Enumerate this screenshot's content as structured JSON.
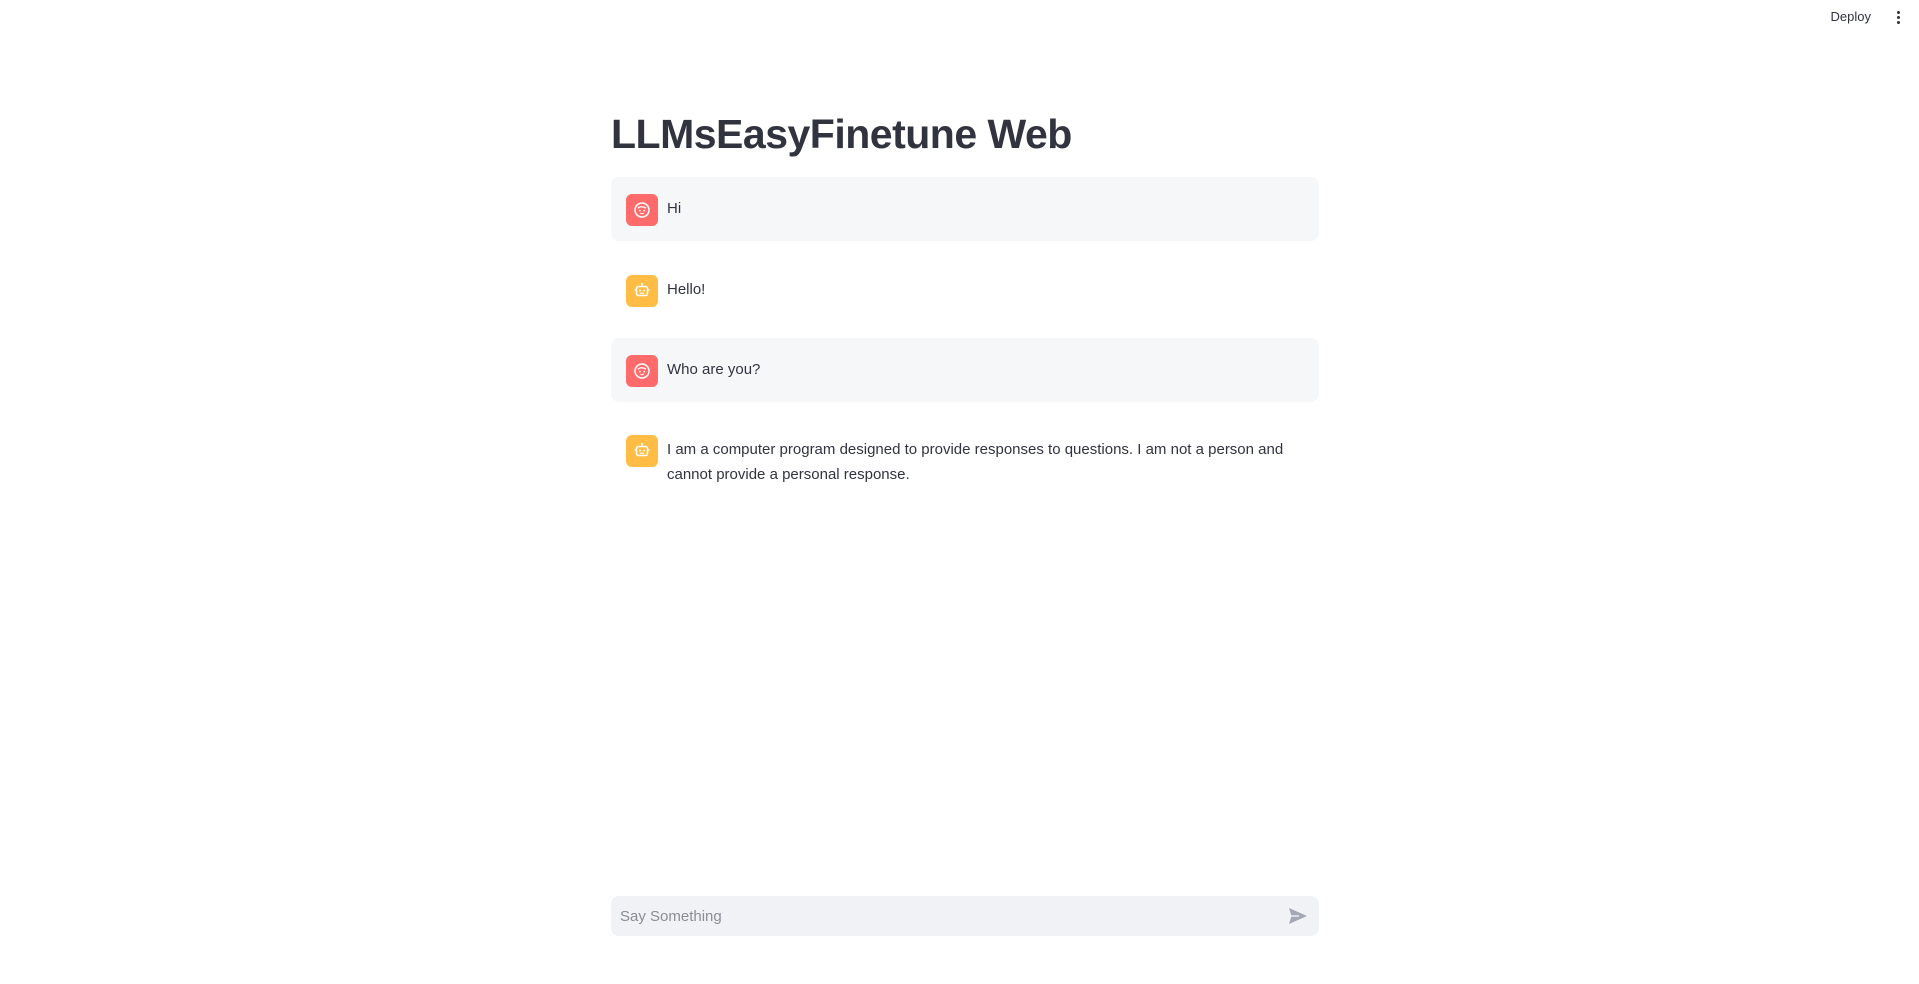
{
  "header": {
    "deploy_label": "Deploy",
    "menu_icon": "more-vertical-icon"
  },
  "main": {
    "title": "LLMsEasyFinetune Web",
    "messages": [
      {
        "role": "user",
        "avatar_icon": "user-face-icon",
        "avatar_color": "#ff6b6b",
        "text": "Hi"
      },
      {
        "role": "assistant",
        "avatar_icon": "robot-icon",
        "avatar_color": "#ffbd45",
        "text": "Hello!"
      },
      {
        "role": "user",
        "avatar_icon": "user-face-icon",
        "avatar_color": "#ff6b6b",
        "text": "Who are you?"
      },
      {
        "role": "assistant",
        "avatar_icon": "robot-icon",
        "avatar_color": "#ffbd45",
        "text": "I am a computer program designed to provide responses to questions. I am not a person and cannot provide a personal response."
      }
    ]
  },
  "chat_input": {
    "placeholder": "Say Something",
    "value": "",
    "send_icon": "send-icon"
  }
}
